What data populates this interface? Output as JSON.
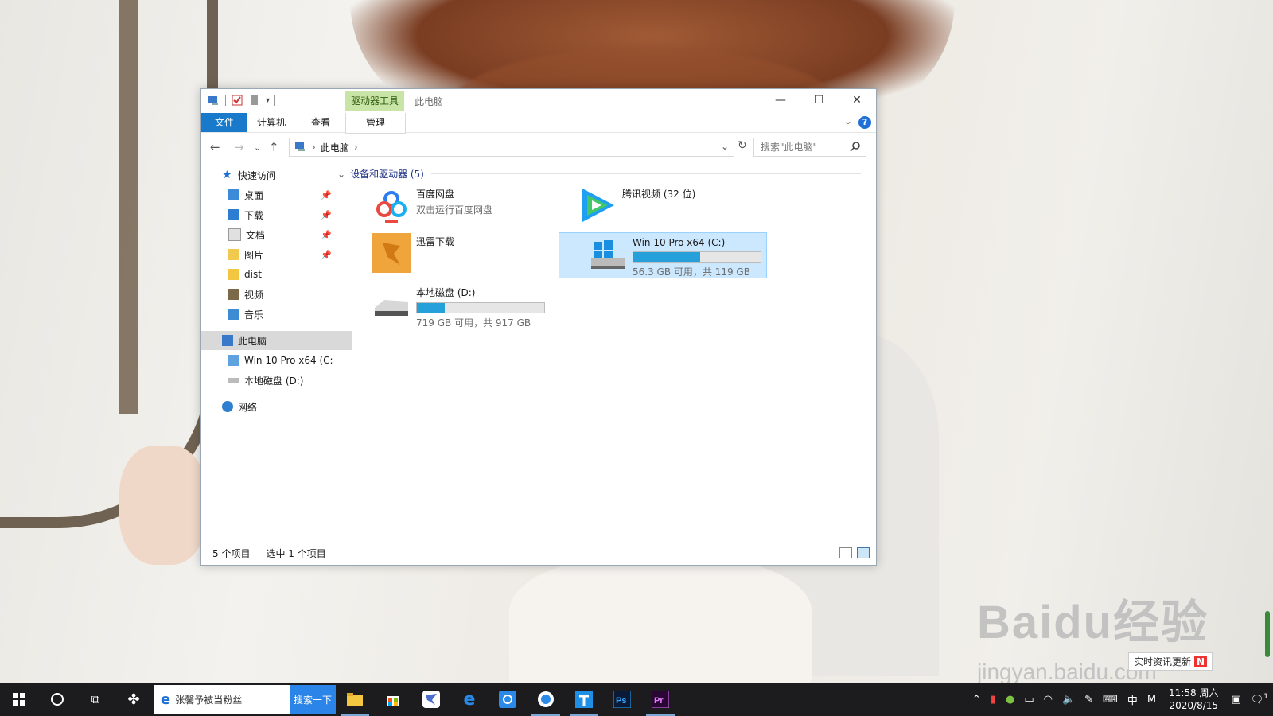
{
  "window": {
    "context_tab": "驱动器工具",
    "title": "此电脑",
    "ribbon_tabs": [
      "文件",
      "计算机",
      "查看",
      "管理"
    ],
    "help": "?"
  },
  "nav": {
    "path": "此电脑",
    "search_placeholder": "搜索\"此电脑\""
  },
  "tree": [
    {
      "label": "快速访问",
      "icon": "star-icon",
      "pinned": false
    },
    {
      "label": "桌面",
      "icon": "desktop-folder-icon",
      "pinned": true
    },
    {
      "label": "下载",
      "icon": "download-folder-icon",
      "pinned": true
    },
    {
      "label": "文档",
      "icon": "documents-folder-icon",
      "pinned": true
    },
    {
      "label": "图片",
      "icon": "pictures-folder-icon",
      "pinned": true
    },
    {
      "label": "dist",
      "icon": "folder-icon",
      "pinned": false
    },
    {
      "label": "视频",
      "icon": "videos-folder-icon",
      "pinned": false
    },
    {
      "label": "音乐",
      "icon": "music-folder-icon",
      "pinned": false
    },
    {
      "label": "此电脑",
      "icon": "computer-icon",
      "pinned": false
    },
    {
      "label": "Win 10 Pro x64 (C:",
      "icon": "system-drive-icon",
      "pinned": false
    },
    {
      "label": "本地磁盘 (D:)",
      "icon": "drive-icon",
      "pinned": false
    },
    {
      "label": "网络",
      "icon": "network-icon",
      "pinned": false
    }
  ],
  "group": {
    "label": "设备和驱动器 (5)"
  },
  "items": {
    "baidu": {
      "name": "百度网盘",
      "sub": "双击运行百度网盘"
    },
    "tencent": {
      "name": "腾讯视频 (32 位)"
    },
    "xunlei": {
      "name": "迅雷下载"
    },
    "c_drive": {
      "name": "Win 10 Pro x64 (C:)",
      "sub": "56.3 GB 可用，共 119 GB",
      "used_fraction": 0.527
    },
    "d_drive": {
      "name": "本地磁盘 (D:)",
      "sub": "719 GB 可用，共 917 GB",
      "used_fraction": 0.216
    }
  },
  "status": {
    "count": "5 个项目",
    "selected": "选中 1 个项目"
  },
  "taskbar": {
    "search_text": "张馨予被当粉丝",
    "search_button": "搜索一下",
    "ime": "中",
    "ime2": "M",
    "time": "11:58 周六",
    "date": "2020/8/15",
    "notifications": "1"
  },
  "wallpaper": {
    "watermark": "Baidu经验",
    "watermark_url": "jingyan.baidu.com",
    "news_label": "实时资讯更新",
    "news_badge": "N"
  },
  "colors": {
    "accent": "#1979ca",
    "context_tab": "#c8e4a6",
    "drive_fill": "#26a0da",
    "selection": "#cce8ff"
  }
}
